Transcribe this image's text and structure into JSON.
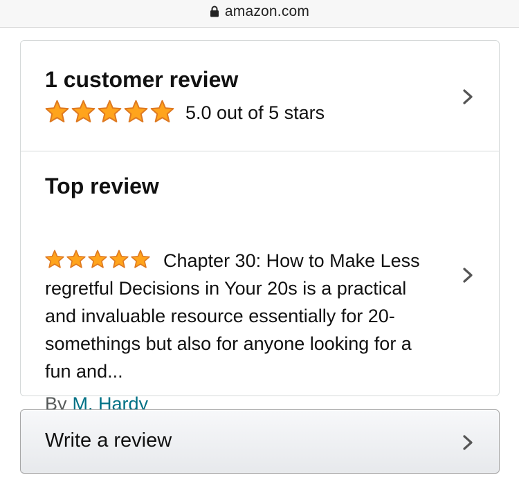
{
  "browser": {
    "url": "amazon.com"
  },
  "summary": {
    "heading": "1 customer review",
    "stars": 5,
    "rating_text": "5.0 out of 5 stars"
  },
  "top_review": {
    "heading": "Top review",
    "stars": 5,
    "body": "Chapter 30: How to Make Less regretful Decisions in Your 20s is a practical and invaluable resource essentially for 20-somethings but also for anyone looking for a fun and...",
    "by_label": "By",
    "author": "M. Hardy"
  },
  "write_review": {
    "label": "Write a review"
  },
  "colors": {
    "star_fill": "#FFA41C",
    "star_stroke": "#DE7921",
    "link": "#007185",
    "border": "#D5D9D9"
  }
}
